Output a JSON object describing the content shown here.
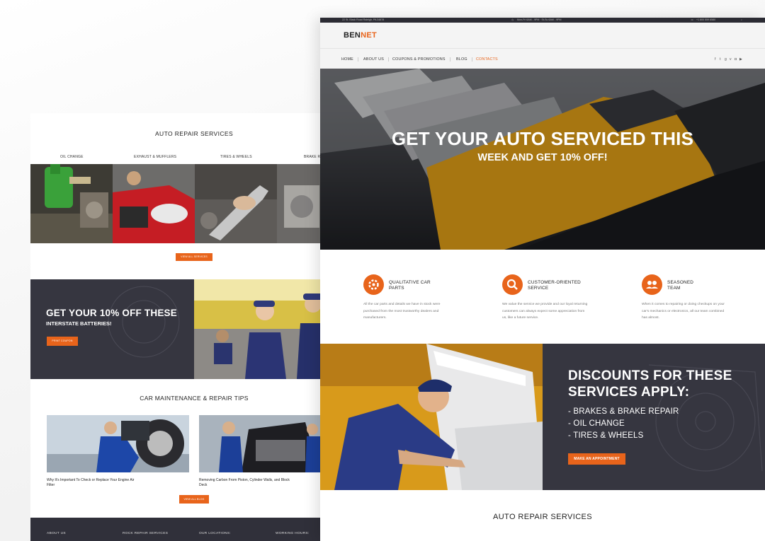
{
  "back": {
    "services_title": "AUTO REPAIR SERVICES",
    "tabs": [
      "OIL CHANGE",
      "EXHAUST & MUFFLERS",
      "TIRES & WHEELS",
      "BRAKE R"
    ],
    "view_all_services": "VIEW ALL SERVICES",
    "promo_heading": "GET YOUR 10% OFF THESE",
    "promo_sub": "INTERSTATE BATTERIES!",
    "promo_button": "PRINT COUPON",
    "tips_title": "CAR MAINTENANCE & REPAIR TIPS",
    "tips": [
      "Why It's Important To Check or Replace Your Engine Air Filter",
      "Removing Carbon From Piston, Cylinder Walls, and Block Deck"
    ],
    "view_all_blog": "VIEW ALL BLOG",
    "footer": [
      "ABOUT US",
      "ROCK REPAIR SERVICES",
      "OUR LOCATIONS:",
      "WORKING HOURS:"
    ]
  },
  "front": {
    "topbar": {
      "address": "22 St. Black Road Raleigh, PA 34878",
      "hours": "Mon-Fri 6AM - 9PM  ·  St-Su 6AM - 9PM",
      "phone": "+1 800 559 6580"
    },
    "logo": {
      "part1": "BEN",
      "part2": "NET"
    },
    "nav": [
      "HOME",
      "ABOUT US",
      "COUPONS & PROMOTIONS",
      "BLOG",
      "CONTACTS"
    ],
    "hero": {
      "line1": "GET YOUR AUTO SERVICED THIS",
      "line2": "WEEK AND GET 10% OFF!"
    },
    "features": [
      {
        "title1": "QUALITATIVE CAR",
        "title2": "PARTS",
        "icon": "gear-icon",
        "desc": "All the car parts and details we have in stock were purchased from the most trustworthy dealers and manufacturers."
      },
      {
        "title1": "CUSTOMER-ORIENTED",
        "title2": "SERVICE",
        "icon": "wrench-icon",
        "desc": "We value the service we provide and our loyal returning customers can always expect some appreciation from us, like a future service."
      },
      {
        "title1": "SEASONED",
        "title2": "TEAM",
        "icon": "team-icon",
        "desc": "When it comes to repairing or doing checkups on your car's mechanics or electronics, all our team combined has almost."
      }
    ],
    "discounts": {
      "heading1": "DISCOUNTS FOR THESE",
      "heading2": "SERVICES APPLY:",
      "items": [
        "- BRAKES & BRAKE REPAIR",
        "- OIL CHANGE",
        "- TIRES & WHEELS"
      ],
      "button": "MAKE AN APPOINTMENT"
    },
    "services_title": "AUTO REPAIR SERVICES"
  },
  "colors": {
    "accent": "#e8641b",
    "dark": "#363640"
  }
}
